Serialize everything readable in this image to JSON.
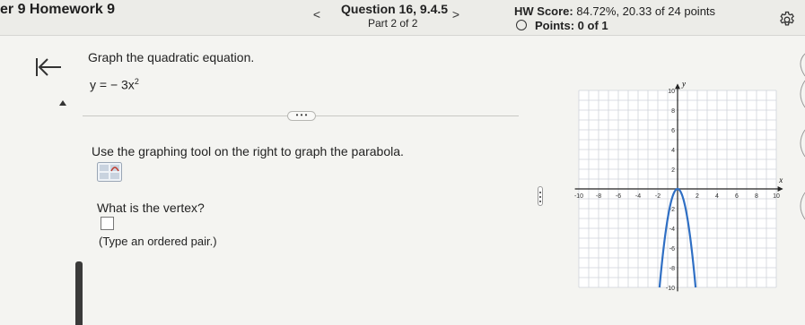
{
  "header": {
    "hw_title": "er 9 Homework 9",
    "prev_label": "<",
    "next_label": ">",
    "question_title": "Question 16, 9.4.5",
    "part": "Part 2 of 2",
    "score_label": "HW Score:",
    "score_value": "84.72%, 20.33 of 24 points",
    "points": "Points: 0 of 1"
  },
  "main": {
    "prompt": "Graph the quadratic equation.",
    "equation_lhs": "y = − 3x",
    "equation_exp": "2",
    "more_label": "• • •",
    "instruction": "Use the graphing tool on the right to graph the parabola.",
    "vertex_question": "What is the vertex?",
    "answer_hint": "(Type an ordered pair.)"
  },
  "graph": {
    "y_axis_label": "y",
    "x_axis_label": "x",
    "x_tick_labels": [
      "-10",
      "-8",
      "-6",
      "-4",
      "-2",
      "2",
      "4",
      "6",
      "8",
      "10"
    ],
    "y_tick_labels": [
      "10",
      "8",
      "6",
      "4",
      "2",
      "-2",
      "-4",
      "-6",
      "-8",
      "-10"
    ],
    "grid_color": "#cfd3da",
    "curve_color": "#2f6fc4",
    "curve_function": "y = -3x^2"
  },
  "icons": {
    "back": "arrow-left-bar-icon",
    "settings": "gear-icon",
    "tool": "graph-tool-icon",
    "status": "circle-outline-icon"
  }
}
